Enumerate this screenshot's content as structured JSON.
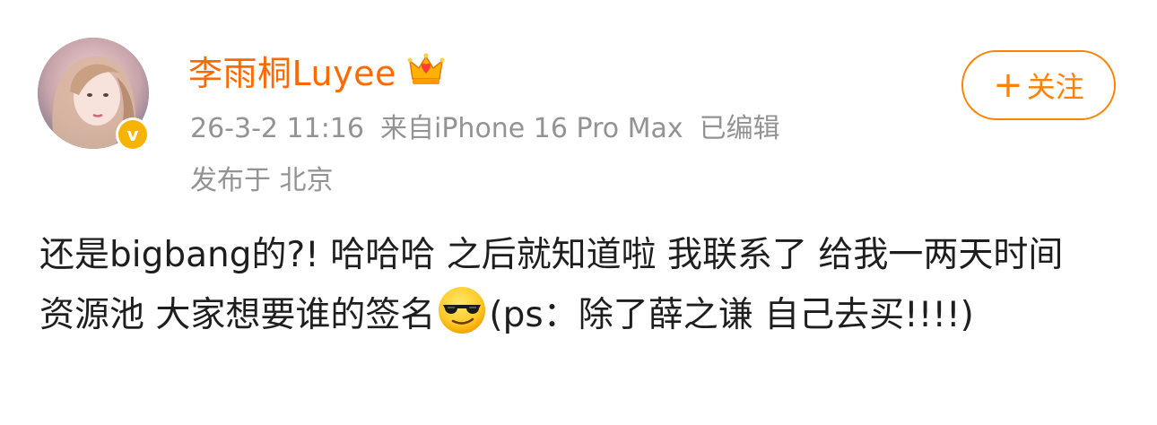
{
  "user": {
    "name": "李雨桐Luyee",
    "crown_icon": "crown-icon",
    "verified_badge": "v",
    "avatar_icon": "avatar-photo"
  },
  "meta": {
    "time": "26-3-2 11:16",
    "source": "来自iPhone 16 Pro Max",
    "edited": "已编辑",
    "location": "发布于 北京"
  },
  "follow_button": {
    "plus": "+",
    "label": "关注"
  },
  "post": {
    "text_part1": "还是bigbang的?!   哈哈哈 之后就知道啦 我联系了 给我一两天时间 资源池 大家想要谁的签名",
    "emoji_name": "sunglasses-emoji",
    "text_part2": "(ps：除了薛之谦 自己去买!!!!)"
  },
  "colors": {
    "accent": "#ff8200",
    "username": "#ff6a00",
    "meta": "#939393",
    "text": "#1e1e1e",
    "badge": "#f6b400"
  }
}
